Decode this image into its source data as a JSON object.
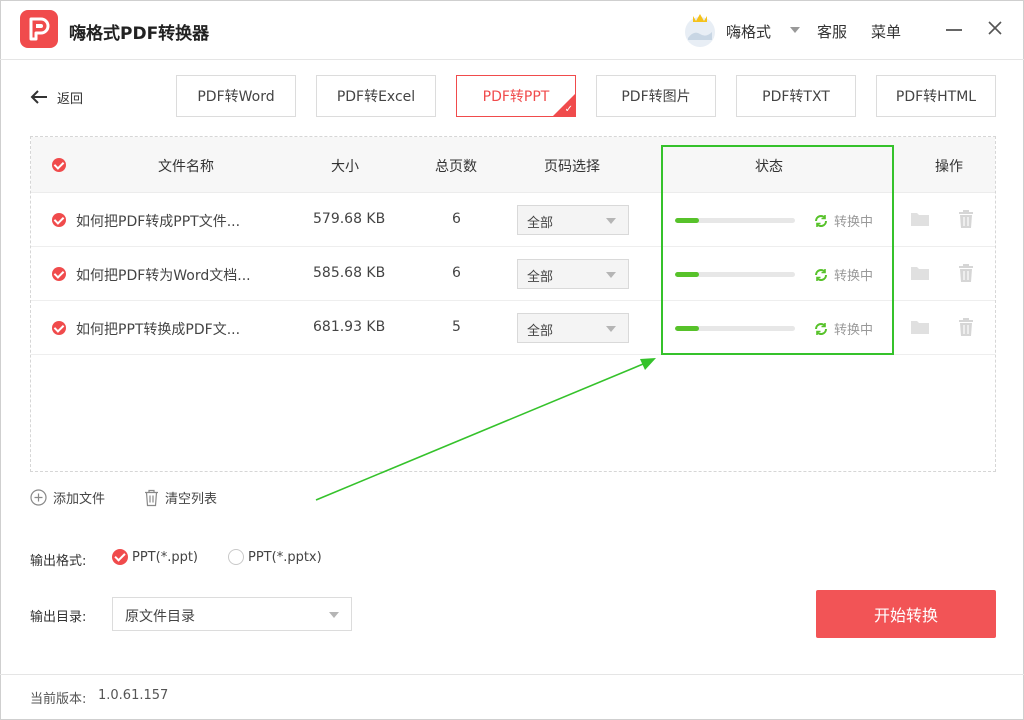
{
  "app": {
    "title": "嗨格式PDF转换器"
  },
  "header": {
    "user_name": "嗨格式",
    "service": "客服",
    "menu": "菜单"
  },
  "nav": {
    "back_label": "返回"
  },
  "tabs": [
    {
      "label": "PDF转Word",
      "active": false
    },
    {
      "label": "PDF转Excel",
      "active": false
    },
    {
      "label": "PDF转PPT",
      "active": true
    },
    {
      "label": "PDF转图片",
      "active": false
    },
    {
      "label": "PDF转TXT",
      "active": false
    },
    {
      "label": "PDF转HTML",
      "active": false
    }
  ],
  "table": {
    "columns": [
      "文件名称",
      "大小",
      "总页数",
      "页码选择",
      "状态",
      "操作"
    ],
    "rows": [
      {
        "name": "如何把PDF转成PPT文件...",
        "size": "579.68 KB",
        "pages": "6",
        "page_select": "全部",
        "progress": 0.2,
        "status": "转换中"
      },
      {
        "name": "如何把PDF转为Word文档...",
        "size": "585.68 KB",
        "pages": "6",
        "page_select": "全部",
        "progress": 0.2,
        "status": "转换中"
      },
      {
        "name": "如何把PPT转换成PDF文...",
        "size": "681.93 KB",
        "pages": "5",
        "page_select": "全部",
        "progress": 0.2,
        "status": "转换中"
      }
    ]
  },
  "actions": {
    "add_file": "添加文件",
    "clear_list": "清空列表"
  },
  "output": {
    "format_label": "输出格式:",
    "formats": [
      {
        "label": "PPT(*.ppt)",
        "selected": true
      },
      {
        "label": "PPT(*.pptx)",
        "selected": false
      }
    ],
    "dir_label": "输出目录:",
    "dir_value": "原文件目录"
  },
  "start_button": "开始转换",
  "footer": {
    "version_label": "当前版本:",
    "version": "1.0.61.157"
  },
  "colors": {
    "accent": "#f04b4c",
    "progress": "#57c22a",
    "highlight": "#35c22b"
  },
  "icons": [
    "app-logo-icon",
    "back-arrow-icon",
    "sync-icon",
    "folder-icon",
    "trash-icon",
    "plus-circle-icon",
    "close-icon",
    "minimize-icon"
  ]
}
